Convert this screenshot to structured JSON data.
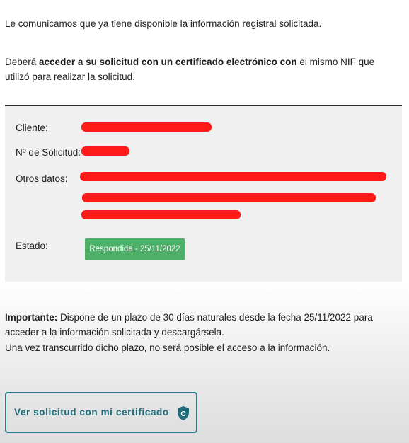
{
  "message": {
    "intro": "Le comunicamos que ya tiene disponible la información registral solicitada.",
    "access_prefix": "Deberá ",
    "access_bold": "acceder a su solicitud con un certificado electrónico con",
    "access_suffix": " el mismo NIF que utilizó para realizar la solicitud."
  },
  "details": {
    "cliente_label": "Cliente:",
    "solicitud_label": "Nº de Solicitud:",
    "otros_label": "Otros datos:",
    "estado_label": "Estado:",
    "estado_value": "Respondida - 25/11/2022",
    "redaction_color": "#ff1a1a",
    "status_color": "#4daf68"
  },
  "notice": {
    "important_label": "Importante:",
    "important_text": " Dispone de un plazo de 30 días naturales desde la fecha 25/11/2022 para acceder a la información solicitada y descargársela.",
    "expiry_text": "Una vez transcurrido dicho plazo, no será posible el acceso a la información."
  },
  "actions": {
    "certificate_button": "Ver solicitud con mi certificado",
    "certificate_icon": "shield-c-icon",
    "accent_color": "#2e7c8a"
  }
}
